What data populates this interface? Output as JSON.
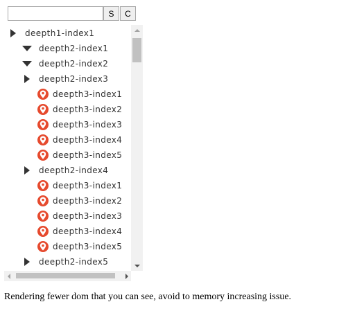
{
  "toolbar": {
    "search_value": "",
    "search_placeholder": "",
    "button_s_label": "S",
    "button_c_label": "C"
  },
  "tree": {
    "rows": [
      {
        "label": "deepth1-index1",
        "type": "parent",
        "state": "collapsed",
        "depth": 1
      },
      {
        "label": "deepth2-index1",
        "type": "parent",
        "state": "expanded",
        "depth": 2
      },
      {
        "label": "deepth2-index2",
        "type": "parent",
        "state": "expanded",
        "depth": 2
      },
      {
        "label": "deepth2-index3",
        "type": "parent",
        "state": "collapsed",
        "depth": 2
      },
      {
        "label": "deepth3-index1",
        "type": "leaf",
        "depth": 3
      },
      {
        "label": "deepth3-index2",
        "type": "leaf",
        "depth": 3
      },
      {
        "label": "deepth3-index3",
        "type": "leaf",
        "depth": 3
      },
      {
        "label": "deepth3-index4",
        "type": "leaf",
        "depth": 3
      },
      {
        "label": "deepth3-index5",
        "type": "leaf",
        "depth": 3
      },
      {
        "label": "deepth2-index4",
        "type": "parent",
        "state": "collapsed",
        "depth": 2
      },
      {
        "label": "deepth3-index1",
        "type": "leaf",
        "depth": 3
      },
      {
        "label": "deepth3-index2",
        "type": "leaf",
        "depth": 3
      },
      {
        "label": "deepth3-index3",
        "type": "leaf",
        "depth": 3
      },
      {
        "label": "deepth3-index4",
        "type": "leaf",
        "depth": 3
      },
      {
        "label": "deepth3-index5",
        "type": "leaf",
        "depth": 3
      },
      {
        "label": "deepth2-index5",
        "type": "parent",
        "state": "collapsed",
        "depth": 2
      },
      {
        "label": "",
        "type": "leaf",
        "depth": 3
      }
    ]
  },
  "colors": {
    "leaf_icon": "#e64a2e",
    "scroll_thumb": "#c1c1c1",
    "scroll_track": "#f1f1f1"
  },
  "icons": {
    "parent_expanded": "triangle-down-icon",
    "parent_collapsed": "triangle-right-icon",
    "leaf": "map-pin-icon"
  },
  "caption": "Rendering fewer dom that you can see, avoid to memory increasing issue."
}
